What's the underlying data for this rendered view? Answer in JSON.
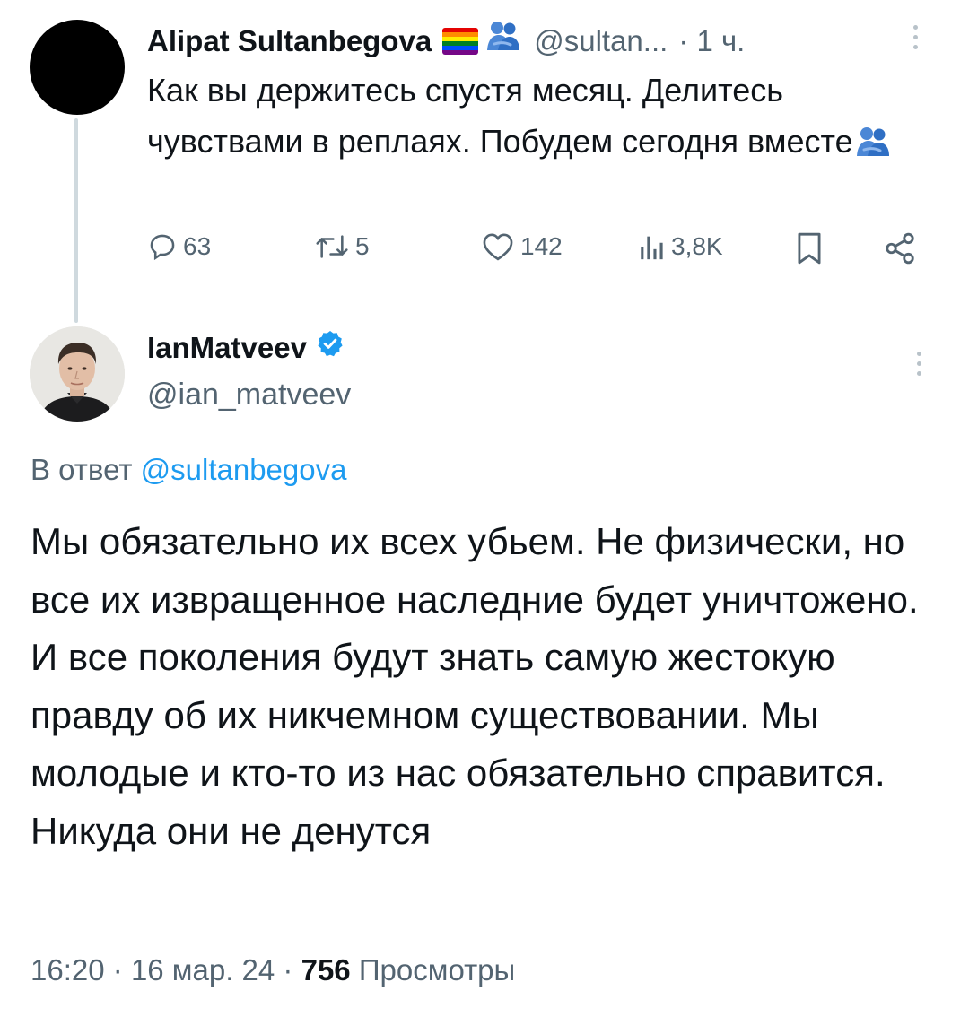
{
  "parent_tweet": {
    "author_name": "Alipat Sultanbegova",
    "author_handle": "@sultan...",
    "time_ago": "· 1 ч.",
    "text": "Как вы держитесь спустя месяц. Делитесь чувствами в реплаях. Побудем сегодня вместе",
    "emoji_icons": [
      "rainbow-flag-icon",
      "people-hugging-icon"
    ],
    "stats": {
      "replies": "63",
      "retweets": "5",
      "likes": "142",
      "views": "3,8K"
    }
  },
  "reply_tweet": {
    "author_name": "IanMatveev",
    "author_handle": "@ian_matveev",
    "verified": true,
    "reply_prefix": "В ответ",
    "reply_to_handle": "@sultanbegova",
    "text": "Мы обязательно их всех убьем. Не физически, но все их извращенное наследние будет уничтожено. И все поколения будут знать самую жестокую правду об их никчемном существовании. Мы молодые и кто-то из нас обязательно справится. Никуда они не денутся",
    "time": "16:20",
    "date": "16 мар. 24",
    "views_count": "756",
    "views_label": "Просмотры"
  },
  "colors": {
    "text": "#0f1419",
    "secondary": "#536471",
    "accent": "#1d9bf0",
    "thread_line": "#cfd9de"
  }
}
